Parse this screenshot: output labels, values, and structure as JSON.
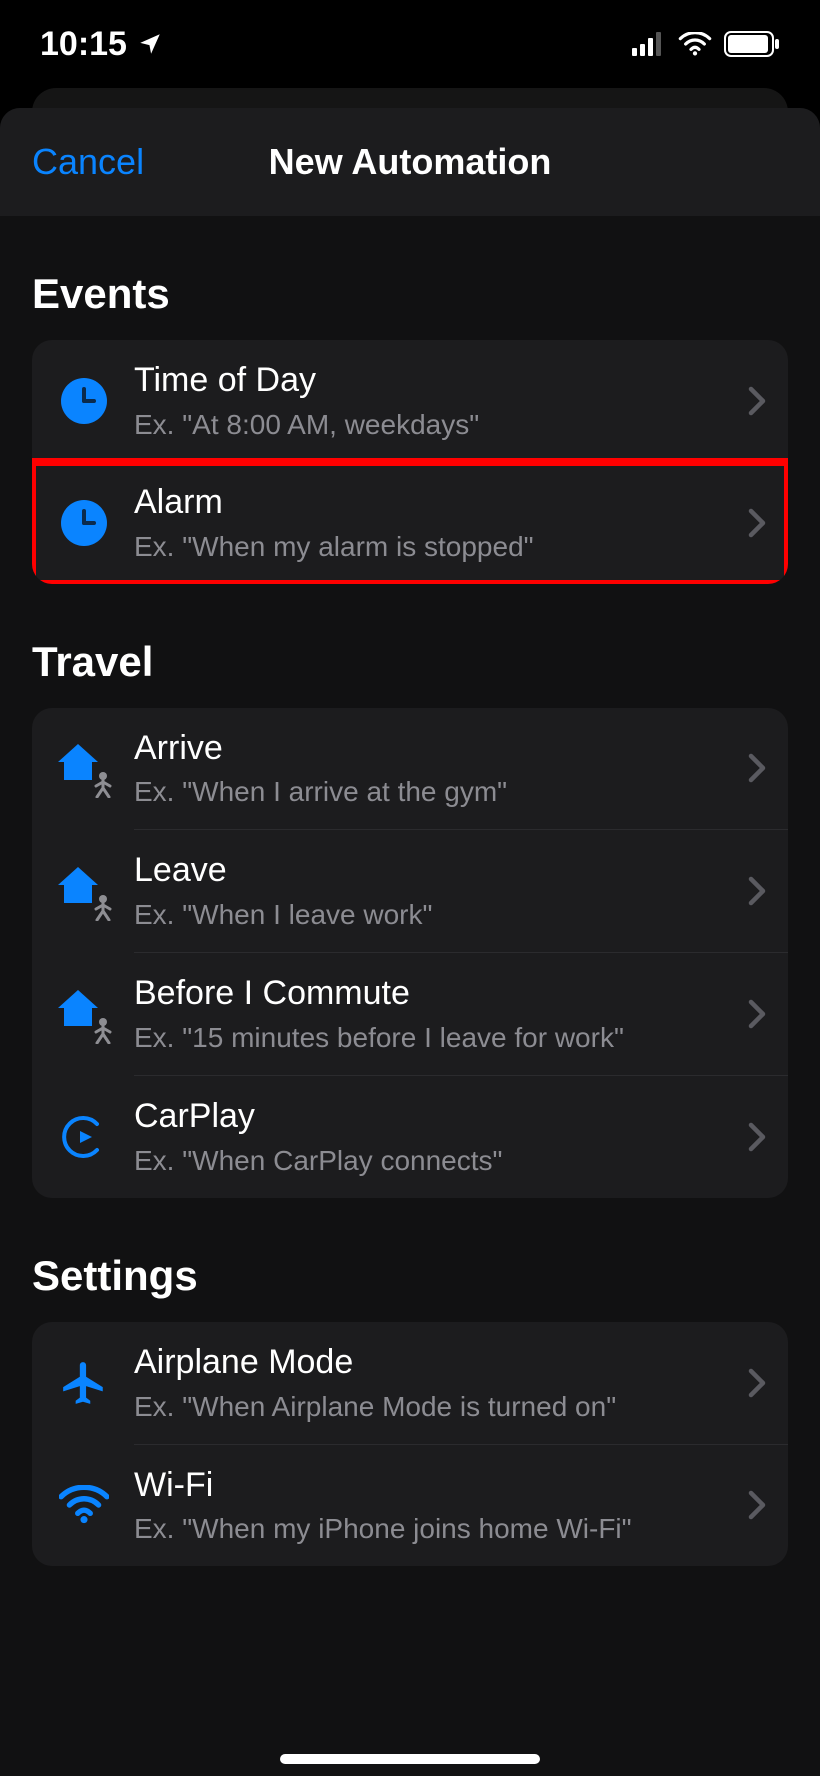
{
  "status": {
    "time": "10:15",
    "location_icon": "location-arrow"
  },
  "nav": {
    "cancel": "Cancel",
    "title": "New Automation"
  },
  "sections": [
    {
      "title": "Events",
      "items": [
        {
          "icon": "clock-icon",
          "title": "Time of Day",
          "subtitle": "Ex. \"At 8:00 AM, weekdays\"",
          "highlighted": false
        },
        {
          "icon": "clock-icon",
          "title": "Alarm",
          "subtitle": "Ex. \"When my alarm is stopped\"",
          "highlighted": true
        }
      ]
    },
    {
      "title": "Travel",
      "items": [
        {
          "icon": "home-person-icon",
          "title": "Arrive",
          "subtitle": "Ex. \"When I arrive at the gym\""
        },
        {
          "icon": "home-person-icon",
          "title": "Leave",
          "subtitle": "Ex. \"When I leave work\""
        },
        {
          "icon": "home-person-icon",
          "title": "Before I Commute",
          "subtitle": "Ex. \"15 minutes before I leave for work\""
        },
        {
          "icon": "carplay-icon",
          "title": "CarPlay",
          "subtitle": "Ex. \"When CarPlay connects\""
        }
      ]
    },
    {
      "title": "Settings",
      "items": [
        {
          "icon": "airplane-icon",
          "title": "Airplane Mode",
          "subtitle": "Ex. \"When Airplane Mode is turned on\""
        },
        {
          "icon": "wifi-icon",
          "title": "Wi-Fi",
          "subtitle": "Ex. \"When my iPhone joins home Wi-Fi\""
        }
      ]
    }
  ],
  "colors": {
    "accent": "#0a84ff",
    "highlight": "#ff0000"
  }
}
